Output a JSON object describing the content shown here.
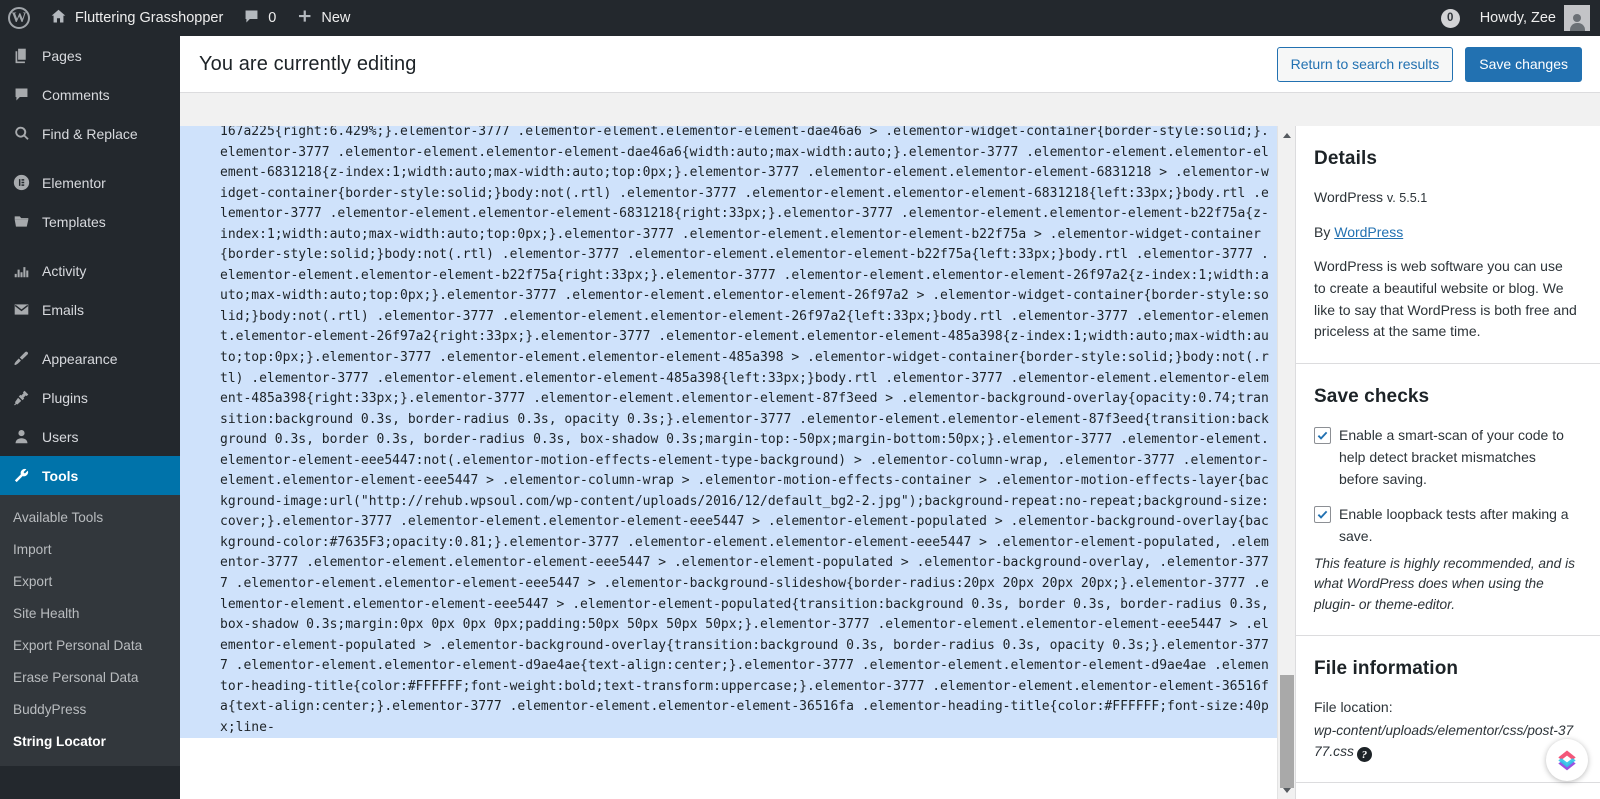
{
  "adminbar": {
    "wp_logo": "wordpress-logo",
    "site_name": "Fluttering Grasshopper",
    "comment_count": "0",
    "new_label": "New",
    "notification_count": "0",
    "howdy": "Howdy, Zee"
  },
  "sidebar": {
    "items": [
      {
        "label": "Pages",
        "icon": "pages-icon",
        "current": false
      },
      {
        "label": "Comments",
        "icon": "comments-icon",
        "current": false
      },
      {
        "label": "Find & Replace",
        "icon": "find-replace-icon",
        "current": false
      },
      {
        "label": "Elementor",
        "icon": "elementor-icon",
        "current": false
      },
      {
        "label": "Templates",
        "icon": "templates-folder-icon",
        "current": false
      },
      {
        "label": "Activity",
        "icon": "activity-icon",
        "current": false
      },
      {
        "label": "Emails",
        "icon": "emails-envelope-icon",
        "current": false
      },
      {
        "label": "Appearance",
        "icon": "appearance-brush-icon",
        "current": false
      },
      {
        "label": "Plugins",
        "icon": "plugins-plug-icon",
        "current": false
      },
      {
        "label": "Users",
        "icon": "users-icon",
        "current": false
      },
      {
        "label": "Tools",
        "icon": "tools-wrench-icon",
        "current": true
      }
    ],
    "submenu": [
      {
        "label": "Available Tools",
        "current": false
      },
      {
        "label": "Import",
        "current": false
      },
      {
        "label": "Export",
        "current": false
      },
      {
        "label": "Site Health",
        "current": false
      },
      {
        "label": "Export Personal Data",
        "current": false
      },
      {
        "label": "Erase Personal Data",
        "current": false
      },
      {
        "label": "BuddyPress",
        "current": false
      },
      {
        "label": "String Locator",
        "current": true
      }
    ]
  },
  "topbar": {
    "title": "You are currently editing",
    "return_button": "Return to search results",
    "save_button": "Save changes"
  },
  "editor": {
    "code": "167a225{right:6.429%;}.elementor-3777 .elementor-element.elementor-element-dae46a6 > .elementor-widget-container{border-style:solid;}.elementor-3777 .elementor-element.elementor-element-dae46a6{width:auto;max-width:auto;}.elementor-3777 .elementor-element.elementor-element-6831218{z-index:1;width:auto;max-width:auto;top:0px;}.elementor-3777 .elementor-element.elementor-element-6831218 > .elementor-widget-container{border-style:solid;}body:not(.rtl) .elementor-3777 .elementor-element.elementor-element-6831218{left:33px;}body.rtl .elementor-3777 .elementor-element.elementor-element-6831218{right:33px;}.elementor-3777 .elementor-element.elementor-element-b22f75a{z-index:1;width:auto;max-width:auto;top:0px;}.elementor-3777 .elementor-element.elementor-element-b22f75a > .elementor-widget-container{border-style:solid;}body:not(.rtl) .elementor-3777 .elementor-element.elementor-element-b22f75a{left:33px;}body.rtl .elementor-3777 .elementor-element.elementor-element-b22f75a{right:33px;}.elementor-3777 .elementor-element.elementor-element-26f97a2{z-index:1;width:auto;max-width:auto;top:0px;}.elementor-3777 .elementor-element.elementor-element-26f97a2 > .elementor-widget-container{border-style:solid;}body:not(.rtl) .elementor-3777 .elementor-element.elementor-element-26f97a2{left:33px;}body.rtl .elementor-3777 .elementor-element.elementor-element-26f97a2{right:33px;}.elementor-3777 .elementor-element.elementor-element-485a398{z-index:1;width:auto;max-width:auto;top:0px;}.elementor-3777 .elementor-element.elementor-element-485a398 > .elementor-widget-container{border-style:solid;}body:not(.rtl) .elementor-3777 .elementor-element.elementor-element-485a398{left:33px;}body.rtl .elementor-3777 .elementor-element.elementor-element-485a398{right:33px;}.elementor-3777 .elementor-element.elementor-element-87f3eed > .elementor-background-overlay{opacity:0.74;transition:background 0.3s, border-radius 0.3s, opacity 0.3s;}.elementor-3777 .elementor-element.elementor-element-87f3eed{transition:background 0.3s, border 0.3s, border-radius 0.3s, box-shadow 0.3s;margin-top:-50px;margin-bottom:50px;}.elementor-3777 .elementor-element.elementor-element-eee5447:not(.elementor-motion-effects-element-type-background) > .elementor-column-wrap, .elementor-3777 .elementor-element.elementor-element-eee5447 > .elementor-column-wrap > .elementor-motion-effects-container > .elementor-motion-effects-layer{background-image:url(\"http://rehub.wpsoul.com/wp-content/uploads/2016/12/default_bg2-2.jpg\");background-repeat:no-repeat;background-size:cover;}.elementor-3777 .elementor-element.elementor-element-eee5447 > .elementor-element-populated > .elementor-background-overlay{background-color:#7635F3;opacity:0.81;}.elementor-3777 .elementor-element.elementor-element-eee5447 > .elementor-element-populated, .elementor-3777 .elementor-element.elementor-element-eee5447 > .elementor-element-populated > .elementor-background-overlay, .elementor-3777 .elementor-element.elementor-element-eee5447 > .elementor-background-slideshow{border-radius:20px 20px 20px 20px;}.elementor-3777 .elementor-element.elementor-element-eee5447 > .elementor-element-populated{transition:background 0.3s, border 0.3s, border-radius 0.3s, box-shadow 0.3s;margin:0px 0px 0px 0px;padding:50px 50px 50px 50px;}.elementor-3777 .elementor-element.elementor-element-eee5447 > .elementor-element-populated > .elementor-background-overlay{transition:background 0.3s, border-radius 0.3s, opacity 0.3s;}.elementor-3777 .elementor-element.elementor-element-d9ae4ae{text-align:center;}.elementor-3777 .elementor-element.elementor-element-d9ae4ae .elementor-heading-title{color:#FFFFFF;font-weight:bold;text-transform:uppercase;}.elementor-3777 .elementor-element.elementor-element-36516fa{text-align:center;}.elementor-3777 .elementor-element.elementor-element-36516fa .elementor-heading-title{color:#FFFFFF;font-size:40px;line-"
  },
  "details": {
    "heading": "Details",
    "version_label": "WordPress",
    "version_value": "v. 5.5.1",
    "by_prefix": "By",
    "by_link": "WordPress",
    "description": "WordPress is web software you can use to create a beautiful website or blog. We like to say that WordPress is both free and priceless at the same time."
  },
  "save_checks": {
    "heading": "Save checks",
    "items": [
      {
        "label": "Enable a smart-scan of your code to help detect bracket mismatches before saving.",
        "checked": true,
        "note": ""
      },
      {
        "label": "Enable loopback tests after making a save.",
        "checked": true,
        "note": "This feature is highly recommended, and is what WordPress does when using the plugin- or theme-editor."
      }
    ]
  },
  "file_information": {
    "heading": "File information",
    "location_label": "File location:",
    "location_value": "wp-content/uploads/elementor/css/post-3777.css",
    "help_glyph": "?"
  },
  "colors": {
    "accent": "#2271b1",
    "admin_bg": "#23282d",
    "submenu_bg": "#32373c",
    "current_menu": "#0073aa",
    "code_selection": "#cfe2fb",
    "checkbox_tick": "#2271b1"
  }
}
